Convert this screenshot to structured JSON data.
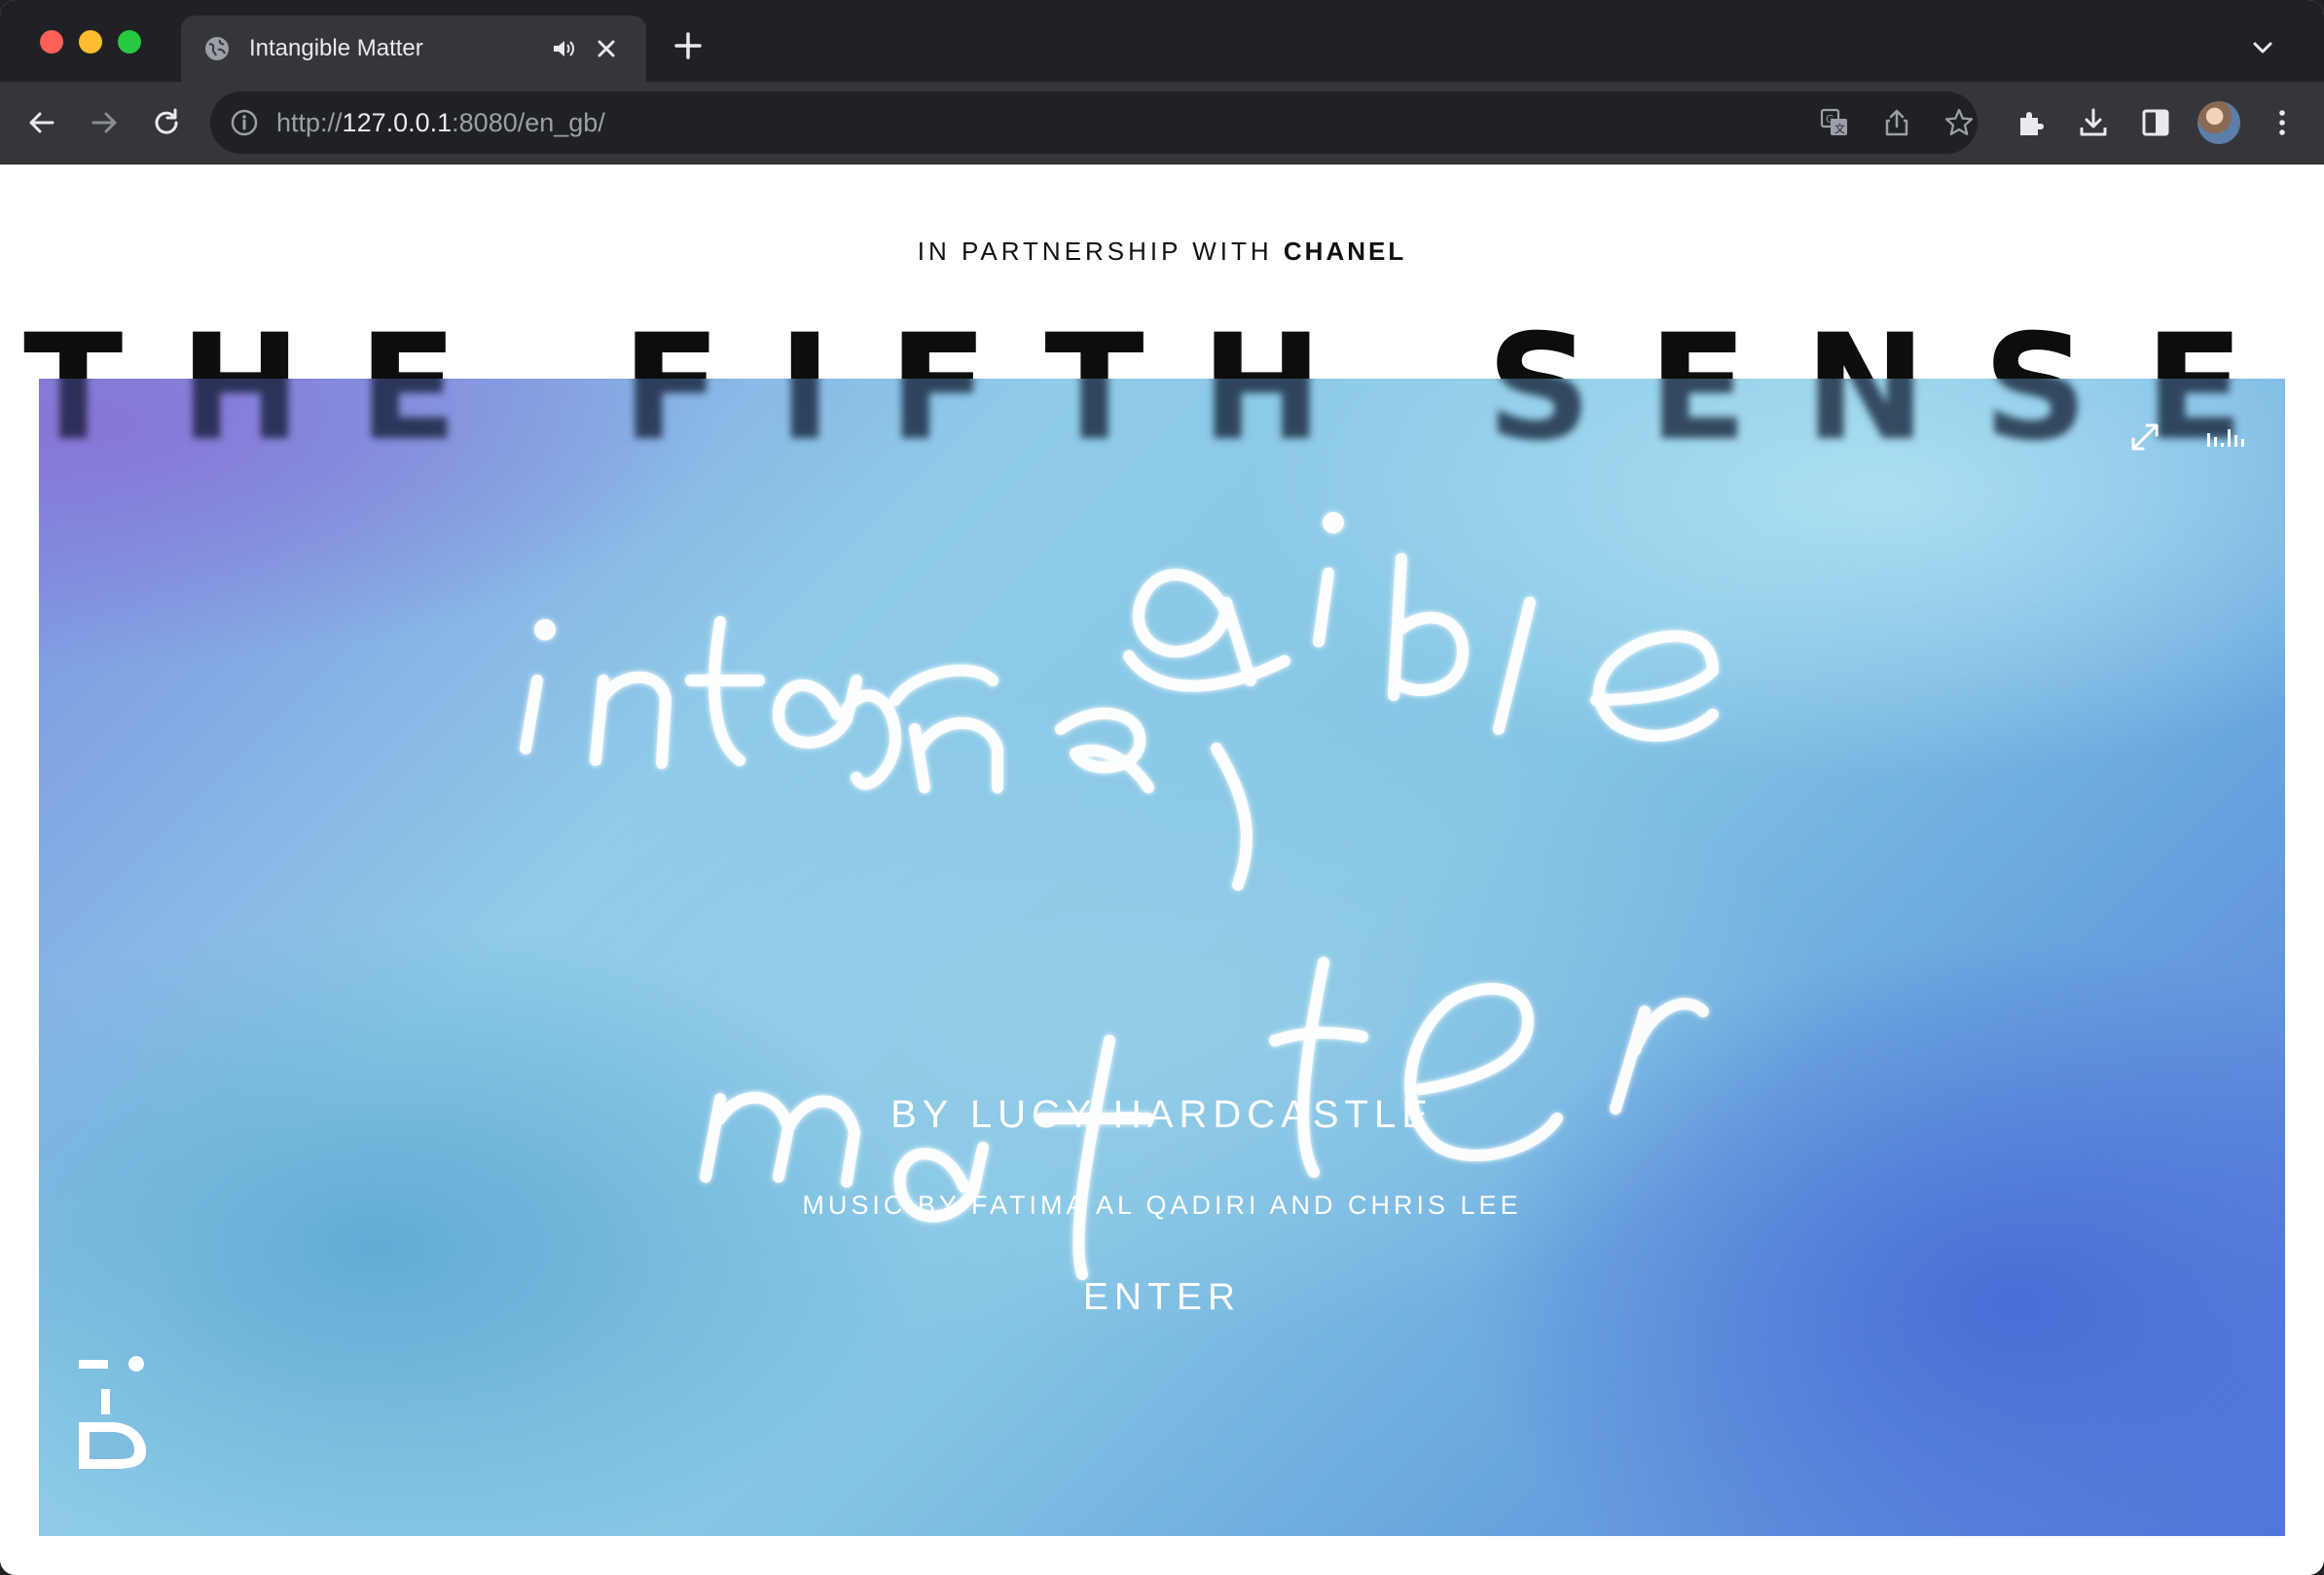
{
  "browser": {
    "tab": {
      "title": "Intangible Matter",
      "favicon": "globe-icon",
      "audio_icon": "speaker-icon",
      "close_icon": "close-icon"
    },
    "new_tab_icon": "plus-icon",
    "tab_menu_icon": "chevron-down-icon",
    "toolbar": {
      "back_icon": "back-arrow-icon",
      "forward_icon": "forward-arrow-icon",
      "reload_icon": "reload-icon",
      "url_scheme": "http://",
      "url_host": "127.0.0.1",
      "url_rest": ":8080/en_gb/",
      "right_icons": [
        "translate-icon",
        "share-icon",
        "star-icon",
        "extensions-icon",
        "download-icon",
        "side-panel-icon",
        "avatar",
        "kebab-menu-icon"
      ]
    }
  },
  "page": {
    "partnership_prefix": "IN PARTNERSHIP WITH",
    "partnership_brand": "CHANEL",
    "title": "THE FIFTH SENSE",
    "hero": {
      "artwork_text": "intangible matter",
      "byline": "BY LUCY HARDCASTLE",
      "music": "MUSIC BY FATIMA AL QADIRI AND CHRIS LEE",
      "enter_label": "ENTER",
      "controls": [
        "fullscreen-icon",
        "sound-bars-icon"
      ],
      "logo": "i-D"
    }
  },
  "colors": {
    "chrome_dark": "#202124",
    "chrome_tab": "#35363a",
    "hero_purple": "#8874d6",
    "hero_light_blue": "#8fcbe8",
    "hero_deep_blue": "#5577dc"
  }
}
